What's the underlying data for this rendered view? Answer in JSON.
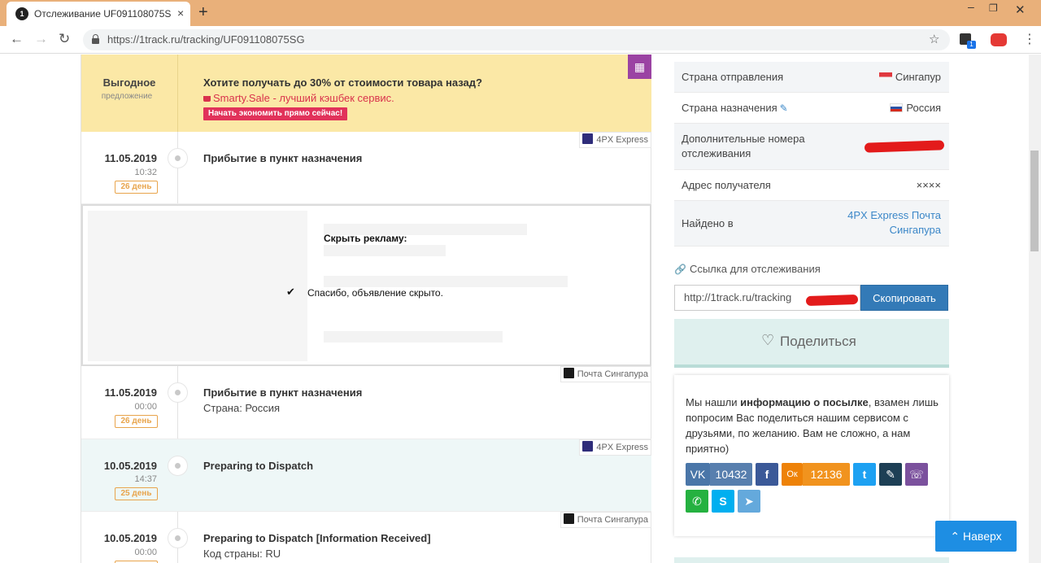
{
  "browser": {
    "tab_title": "Отслеживание UF091108075SG",
    "tab_close": "×",
    "new_tab": "+",
    "url": "https://1track.ru/tracking/UF091108075SG",
    "win_min": "–",
    "win_max": "❐",
    "win_close": "✕",
    "ext_badge": "1"
  },
  "promo": {
    "left_title": "Выгодное",
    "left_sub": "предложение",
    "headline": "Хотите получать до 30% от стоимости товара назад?",
    "sub": "Smarty.Sale - лучший кэшбек сервис.",
    "button": "Начать экономить прямо сейчас!"
  },
  "events": [
    {
      "date": "11.05.2019",
      "time": "10:32",
      "badge": "26 день",
      "title": "Прибытие в пункт назначения",
      "sub": "",
      "carrier": "4PX Express"
    },
    {
      "date": "11.05.2019",
      "time": "00:00",
      "badge": "26 день",
      "title": "Прибытие в пункт назначения",
      "sub": "Страна: Россия",
      "carrier": "Почта Сингапура"
    },
    {
      "date": "10.05.2019",
      "time": "14:37",
      "badge": "25 день",
      "title": "Preparing to Dispatch",
      "sub": "",
      "carrier": "4PX Express"
    },
    {
      "date": "10.05.2019",
      "time": "00:00",
      "badge": "",
      "title": "Preparing to Dispatch [Information Received]",
      "sub": "Код страны: RU",
      "carrier": "Почта Сингапура"
    }
  ],
  "ad": {
    "hide_label": "Скрыть рекламу:",
    "check": "✔",
    "thanks": "Спасибо, объявление скрыто."
  },
  "info": {
    "origin_label": "Страна отправления",
    "origin_value": "Сингапур",
    "dest_label": "Страна назначения",
    "dest_value": "Россия",
    "extra_label": "Дополнительные номера отслеживания",
    "address_label": "Адрес получателя",
    "address_value": "××××",
    "found_label": "Найдено в",
    "found_value": "4PX Express Почта Сингапура"
  },
  "link": {
    "label": "Ссылка для отслеживания",
    "value": "http://1track.ru/tracking",
    "copy_button": "Скопировать"
  },
  "share": {
    "button": "Поделиться",
    "text_pre": "Мы нашли ",
    "text_bold": "информацию о посылке",
    "text_post": ", взамен лишь попросим Вас поделиться нашим сервисом с друзьями, по желанию. Вам не сложно, а нам приятно)",
    "vk_label": "VK",
    "vk_count": "10432",
    "fb_label": "f",
    "ok_label": "Ок",
    "ok_count": "12136",
    "tw_label": "t",
    "lj_label": "✎",
    "viber_label": "☏",
    "wa_label": "✆",
    "skype_label": "S",
    "tg_label": "➤"
  },
  "up_button": "Наверх",
  "colors": {
    "promo_bg": "#fbe8a6",
    "accent_blue": "#337ab7",
    "badge_orange": "#e8a44b",
    "promo_red": "#e1325a"
  }
}
